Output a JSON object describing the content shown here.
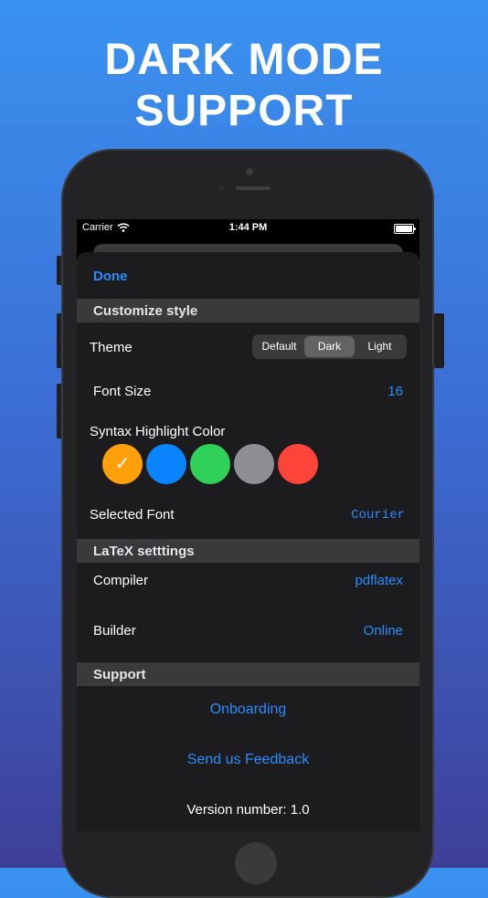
{
  "headline": {
    "line1": "DARK MODE",
    "line2": "SUPPORT"
  },
  "statusbar": {
    "carrier": "Carrier",
    "time": "1:44 PM"
  },
  "sheet": {
    "done_label": "Done",
    "customize": {
      "header": "Customize style",
      "theme_label": "Theme",
      "theme_options": [
        "Default",
        "Dark",
        "Light"
      ],
      "theme_selected": "Dark",
      "font_size_label": "Font Size",
      "font_size_value": "16",
      "syntax_label": "Syntax Highlight Color",
      "colors": [
        "#ff9f0a",
        "#0a84ff",
        "#30d158",
        "#8e8e93",
        "#ff453a"
      ],
      "selected_color": "#ff9f0a",
      "selected_font_label": "Selected Font",
      "selected_font_value": "Courier"
    },
    "latex": {
      "header": "LaTeX setttings",
      "compiler_label": "Compiler",
      "compiler_value": "pdflatex",
      "builder_label": "Builder",
      "builder_value": "Online"
    },
    "support": {
      "header": "Support",
      "onboarding": "Onboarding",
      "feedback": "Send us Feedback",
      "version": "Version number: 1.0"
    }
  },
  "colors": {
    "accent": "#2b8cff",
    "sheet_bg": "#1c1c1e",
    "section_bg": "#3a3a3c"
  }
}
